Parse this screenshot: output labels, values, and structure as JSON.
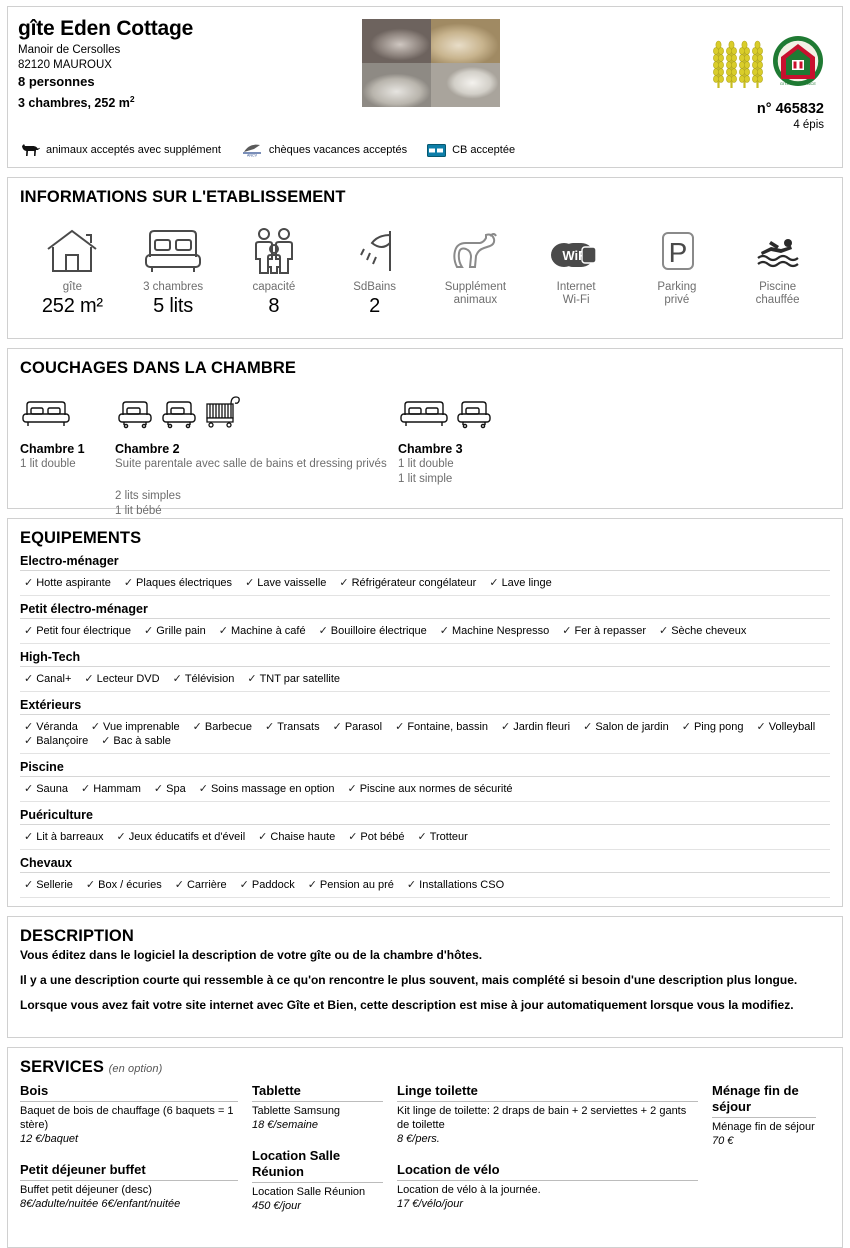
{
  "header": {
    "title": "gîte Eden Cottage",
    "place": "Manoir de Cersolles",
    "city": "82120 MAUROUX",
    "persons": "8 personnes",
    "rooms_area_prefix": "3 chambres, 252 m",
    "rooms_area_sup": "2",
    "number": "n° 465832",
    "epis_label": "4 épis",
    "epis_count": 4,
    "logo_text": "GITES DE FRANCE",
    "payments": [
      {
        "icon": "dog-icon",
        "label": "animaux acceptés avec supplément"
      },
      {
        "icon": "ancv-icon",
        "label": "chèques vacances acceptés"
      },
      {
        "icon": "credit-card-icon",
        "label": "CB acceptée"
      }
    ]
  },
  "infos": {
    "title": "INFORMATIONS SUR L'ETABLISSEMENT",
    "cells": [
      {
        "icon": "house-icon",
        "label": "gîte",
        "value": "252 m²"
      },
      {
        "icon": "double-bed-icon",
        "label": "3 chambres",
        "value": "5 lits"
      },
      {
        "icon": "family-icon",
        "label": "capacité",
        "value": "8"
      },
      {
        "icon": "shower-icon",
        "label": "SdBains",
        "value": "2"
      },
      {
        "icon": "dog-sitting-icon",
        "label": "Supplément\nanimaux",
        "value": ""
      },
      {
        "icon": "wifi-icon",
        "label": "Internet\nWi-Fi",
        "value": ""
      },
      {
        "icon": "parking-icon",
        "label": "Parking\nprivé",
        "value": ""
      },
      {
        "icon": "swimmer-icon",
        "label": "Piscine\nchauffée",
        "value": ""
      }
    ],
    "labels": {
      "c1": "gîte",
      "c2": "3 chambres",
      "c3": "capacité",
      "c4": "SdBains",
      "c5a": "Supplément",
      "c5b": "animaux",
      "c6a": "Internet",
      "c6b": "Wi-Fi",
      "c7a": "Parking",
      "c7b": "privé",
      "c8a": "Piscine",
      "c8b": "chauffée"
    },
    "values": {
      "v1": "252 m²",
      "v2": "5 lits",
      "v3": "8",
      "v4": "2"
    }
  },
  "couchages": {
    "title": "COUCHAGES DANS LA CHAMBRE",
    "rooms": [
      {
        "name": "Chambre 1",
        "beds": [
          "double"
        ],
        "desc": "1 lit double",
        "desc2": ""
      },
      {
        "name": "Chambre 2",
        "beds": [
          "single",
          "single",
          "cot"
        ],
        "desc": "Suite parentale avec salle de bains et dressing privés",
        "desc2": "2 lits simples\n1 lit bébé",
        "desc2a": "2 lits simples",
        "desc2b": "1 lit bébé"
      },
      {
        "name": "Chambre 3",
        "beds": [
          "double",
          "single"
        ],
        "desc": "1 lit double\n1 lit simple",
        "desc_a": "1 lit double",
        "desc_b": "1 lit simple",
        "desc2": ""
      }
    ]
  },
  "equipements": {
    "title": "EQUIPEMENTS",
    "groups": [
      {
        "name": "Electro-ménager",
        "items": [
          "Hotte aspirante",
          "Plaques électriques",
          "Lave vaisselle",
          "Réfrigérateur congélateur",
          "Lave linge"
        ]
      },
      {
        "name": "Petit électro-ménager",
        "items": [
          "Petit four électrique",
          "Grille pain",
          "Machine à café",
          "Bouilloire électrique",
          "Machine Nespresso",
          "Fer à repasser",
          "Sèche cheveux"
        ]
      },
      {
        "name": "High-Tech",
        "items": [
          "Canal+",
          "Lecteur DVD",
          "Télévision",
          "TNT par satellite"
        ]
      },
      {
        "name": "Extérieurs",
        "items": [
          "Véranda",
          "Vue imprenable",
          "Barbecue",
          "Transats",
          "Parasol",
          "Fontaine, bassin",
          "Jardin fleuri",
          "Salon de jardin",
          "Ping pong",
          "Volleyball",
          "Balançoire",
          "Bac à sable"
        ]
      },
      {
        "name": "Piscine",
        "items": [
          "Sauna",
          "Hammam",
          "Spa",
          "Soins massage en option",
          "Piscine aux normes de sécurité"
        ]
      },
      {
        "name": "Puériculture",
        "items": [
          "Lit à barreaux",
          "Jeux éducatifs et d'éveil",
          "Chaise haute",
          "Pot bébé",
          "Trotteur"
        ]
      },
      {
        "name": "Chevaux",
        "items": [
          "Sellerie",
          "Box / écuries",
          "Carrière",
          "Paddock",
          "Pension au pré",
          "Installations CSO"
        ]
      }
    ]
  },
  "description": {
    "title": "DESCRIPTION",
    "paragraphs": [
      "Vous éditez dans le logiciel la description de votre gîte ou de la chambre d'hôtes.",
      "Il y a une description courte qui ressemble à ce qu'on rencontre le plus souvent, mais complété si besoin d'une description plus longue.",
      "Lorsque vous avez fait votre site internet avec Gîte et Bien, cette description est mise à jour automatiquement lorsque vous la modifiez."
    ]
  },
  "services": {
    "title": "SERVICES",
    "subtitle": "(en option)",
    "columns": [
      [
        {
          "name": "Bois",
          "desc": "Baquet de bois de chauffage (6 baquets = 1 stère)",
          "price": "12 €/baquet"
        },
        {
          "name": "Petit déjeuner buffet",
          "desc": "Buffet petit déjeuner (desc)",
          "price": "8€/adulte/nuitée 6€/enfant/nuitée"
        }
      ],
      [
        {
          "name": "Tablette",
          "desc": "Tablette Samsung",
          "price": "18 €/semaine"
        },
        {
          "name": "Location Salle Réunion",
          "desc": "Location Salle Réunion",
          "price": "450 €/jour"
        }
      ],
      [
        {
          "name": "Linge toilette",
          "desc": "Kit linge de toilette: 2 draps de bain + 2 serviettes + 2 gants de toilette",
          "price": "8 €/pers."
        },
        {
          "name": "Location de vélo",
          "desc": "Location de vélo à la journée.",
          "price": "17 €/vélo/jour"
        }
      ],
      [
        {
          "name": "Ménage fin de séjour",
          "desc": "Ménage fin de séjour",
          "price": "70 €"
        }
      ]
    ]
  },
  "colors": {
    "panel_border": "#d0d0d0",
    "muted_text": "#6e6e6e",
    "logo_green": "#1f7a33",
    "logo_red": "#c8102e",
    "epi_yellow": "#d9cd2a",
    "cb_blue": "#0d7ea8"
  }
}
